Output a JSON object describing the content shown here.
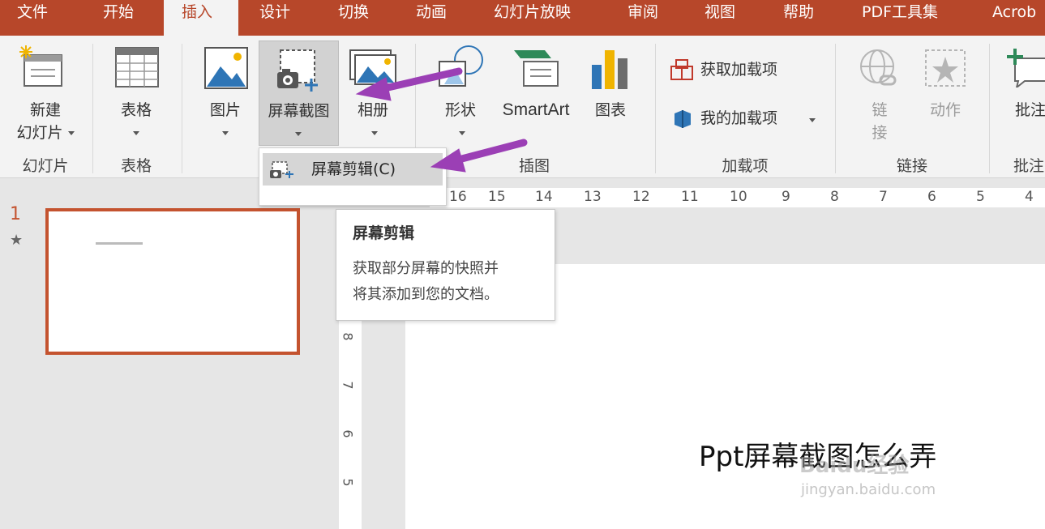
{
  "tabs": [
    {
      "label": "文件"
    },
    {
      "label": "开始"
    },
    {
      "label": "插入"
    },
    {
      "label": "设计"
    },
    {
      "label": "切换"
    },
    {
      "label": "动画"
    },
    {
      "label": "幻灯片放映"
    },
    {
      "label": "审阅"
    },
    {
      "label": "视图"
    },
    {
      "label": "帮助"
    },
    {
      "label": "PDF工具集"
    },
    {
      "label": "Acrob"
    }
  ],
  "ribbon": {
    "slides": {
      "new_slide_line1": "新建",
      "new_slide_line2": "幻灯片",
      "group": "幻灯片"
    },
    "tables": {
      "table": "表格",
      "group": "表格"
    },
    "images": {
      "picture": "图片",
      "screenshot": "屏幕截图",
      "album": "相册"
    },
    "illustrations": {
      "shapes": "形状",
      "smartart": "SmartArt",
      "chart": "图表",
      "group": "插图"
    },
    "addins": {
      "get": "获取加载项",
      "my": "我的加载项",
      "group": "加载项"
    },
    "links": {
      "link_line1": "链",
      "link_line2": "接",
      "action": "动作",
      "group": "链接"
    },
    "comments": {
      "comment": "批注",
      "group": "批注"
    }
  },
  "dropdown": {
    "item": "屏幕剪辑(C)"
  },
  "tooltip": {
    "title": "屏幕剪辑",
    "line1": "获取部分屏幕的快照并",
    "line2": "将其添加到您的文档。"
  },
  "slide_panel": {
    "number": "1",
    "star": "★"
  },
  "slide": {
    "title": "Ppt屏幕截图怎么弄"
  },
  "ruler": {
    "h_labels": [
      "16",
      "15",
      "14",
      "13",
      "12",
      "11",
      "10",
      "9",
      "8",
      "7",
      "6",
      "5",
      "4"
    ],
    "v_labels": [
      "8",
      "7",
      "6",
      "5"
    ]
  },
  "watermark": {
    "brand": "Baidu经验",
    "url": "jingyan.baidu.com"
  },
  "colors": {
    "accent": "#b7472a",
    "arrow": "#9b3fb5"
  }
}
